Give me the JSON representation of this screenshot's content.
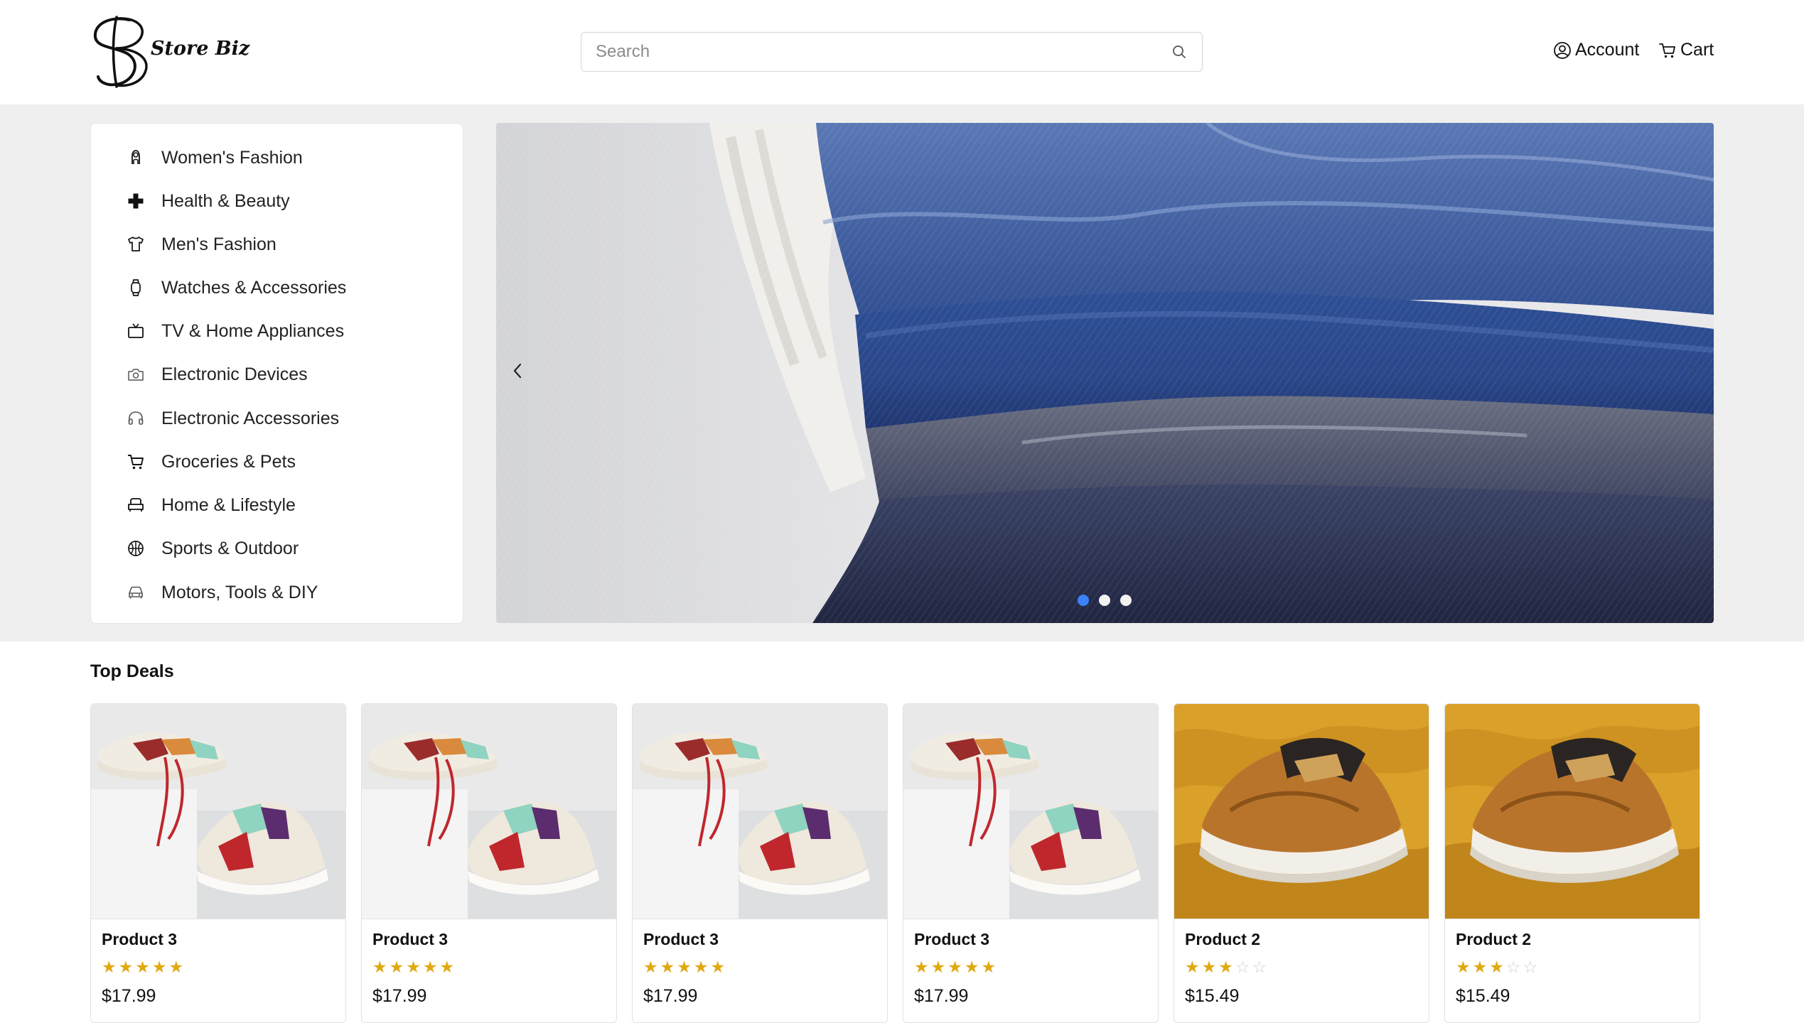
{
  "header": {
    "logo_text": "Store Biz",
    "search_placeholder": "Search",
    "account_label": "Account",
    "cart_label": "Cart"
  },
  "categories": [
    {
      "label": "Women's Fashion",
      "icon": "woman-icon"
    },
    {
      "label": "Health & Beauty",
      "icon": "medical-cross-icon"
    },
    {
      "label": "Men's Fashion",
      "icon": "tshirt-icon"
    },
    {
      "label": "Watches & Accessories",
      "icon": "watch-icon"
    },
    {
      "label": "TV & Home Appliances",
      "icon": "tv-icon"
    },
    {
      "label": "Electronic Devices",
      "icon": "camera-icon"
    },
    {
      "label": "Electronic Accessories",
      "icon": "headphones-icon"
    },
    {
      "label": "Groceries & Pets",
      "icon": "cart-icon"
    },
    {
      "label": "Home & Lifestyle",
      "icon": "sofa-icon"
    },
    {
      "label": "Sports & Outdoor",
      "icon": "basketball-icon"
    },
    {
      "label": "Motors, Tools & DIY",
      "icon": "car-icon"
    }
  ],
  "carousel": {
    "slide_count": 3,
    "active_slide": 0,
    "image": "stacked-jeans-photo"
  },
  "top_deals": {
    "title": "Top Deals",
    "products": [
      {
        "name": "Product 3",
        "rating": 5,
        "price": "$17.99",
        "image": "white-sneakers-photo"
      },
      {
        "name": "Product 3",
        "rating": 5,
        "price": "$17.99",
        "image": "white-sneakers-photo"
      },
      {
        "name": "Product 3",
        "rating": 5,
        "price": "$17.99",
        "image": "white-sneakers-photo"
      },
      {
        "name": "Product 3",
        "rating": 5,
        "price": "$17.99",
        "image": "white-sneakers-photo"
      },
      {
        "name": "Product 2",
        "rating": 3,
        "price": "$15.49",
        "image": "brown-sneaker-photo"
      },
      {
        "name": "Product 2",
        "rating": 3,
        "price": "$15.49",
        "image": "brown-sneaker-photo"
      }
    ]
  },
  "colors": {
    "accent_blue": "#3b82f6",
    "star_gold": "#e0a912",
    "band_gray": "#efefef"
  }
}
